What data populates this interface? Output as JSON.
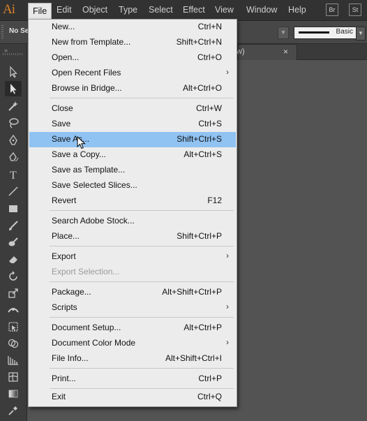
{
  "app": {
    "logo": "Ai"
  },
  "menubar": {
    "items": [
      {
        "label": "File",
        "active": true
      },
      {
        "label": "Edit"
      },
      {
        "label": "Object"
      },
      {
        "label": "Type"
      },
      {
        "label": "Select"
      },
      {
        "label": "Effect"
      },
      {
        "label": "View"
      },
      {
        "label": "Window"
      },
      {
        "label": "Help"
      }
    ],
    "bridge_buttons": [
      "Br",
      "St"
    ]
  },
  "control_bar": {
    "selection_label": "No Se",
    "stroke_profile": "Basic"
  },
  "document_tab": {
    "label": "w)",
    "close": "×"
  },
  "tools": [
    "selection-tool",
    "direct-selection-tool",
    "magic-wand-tool",
    "lasso-tool",
    "pen-tool",
    "curvature-tool",
    "type-tool",
    "line-tool",
    "rectangle-tool",
    "paintbrush-tool",
    "blob-brush-tool",
    "eraser-tool",
    "rotate-tool",
    "scale-tool",
    "width-tool",
    "free-transform-tool",
    "shape-builder-tool",
    "perspective-grid-tool",
    "mesh-tool",
    "gradient-tool",
    "eyedropper-tool"
  ],
  "file_menu": {
    "items": [
      {
        "label": "New...",
        "shortcut": "Ctrl+N"
      },
      {
        "label": "New from Template...",
        "shortcut": "Shift+Ctrl+N"
      },
      {
        "label": "Open...",
        "shortcut": "Ctrl+O"
      },
      {
        "label": "Open Recent Files",
        "shortcut": "",
        "submenu": true
      },
      {
        "label": "Browse in Bridge...",
        "shortcut": "Alt+Ctrl+O"
      },
      {
        "label": "Close",
        "shortcut": "Ctrl+W"
      },
      {
        "label": "Save",
        "shortcut": "Ctrl+S"
      },
      {
        "label": "Save As...",
        "shortcut": "Shift+Ctrl+S",
        "highlighted": true
      },
      {
        "label": "Save a Copy...",
        "shortcut": "Alt+Ctrl+S"
      },
      {
        "label": "Save as Template...",
        "shortcut": ""
      },
      {
        "label": "Save Selected Slices...",
        "shortcut": ""
      },
      {
        "label": "Revert",
        "shortcut": "F12"
      },
      {
        "label": "Search Adobe Stock...",
        "shortcut": ""
      },
      {
        "label": "Place...",
        "shortcut": "Shift+Ctrl+P"
      },
      {
        "label": "Export",
        "shortcut": "",
        "submenu": true
      },
      {
        "label": "Export Selection...",
        "shortcut": "",
        "disabled": true
      },
      {
        "label": "Package...",
        "shortcut": "Alt+Shift+Ctrl+P"
      },
      {
        "label": "Scripts",
        "shortcut": "",
        "submenu": true
      },
      {
        "label": "Document Setup...",
        "shortcut": "Alt+Ctrl+P"
      },
      {
        "label": "Document Color Mode",
        "shortcut": "",
        "submenu": true
      },
      {
        "label": "File Info...",
        "shortcut": "Alt+Shift+Ctrl+I"
      },
      {
        "label": "Print...",
        "shortcut": "Ctrl+P"
      },
      {
        "label": "Exit",
        "shortcut": "Ctrl+Q"
      }
    ]
  }
}
